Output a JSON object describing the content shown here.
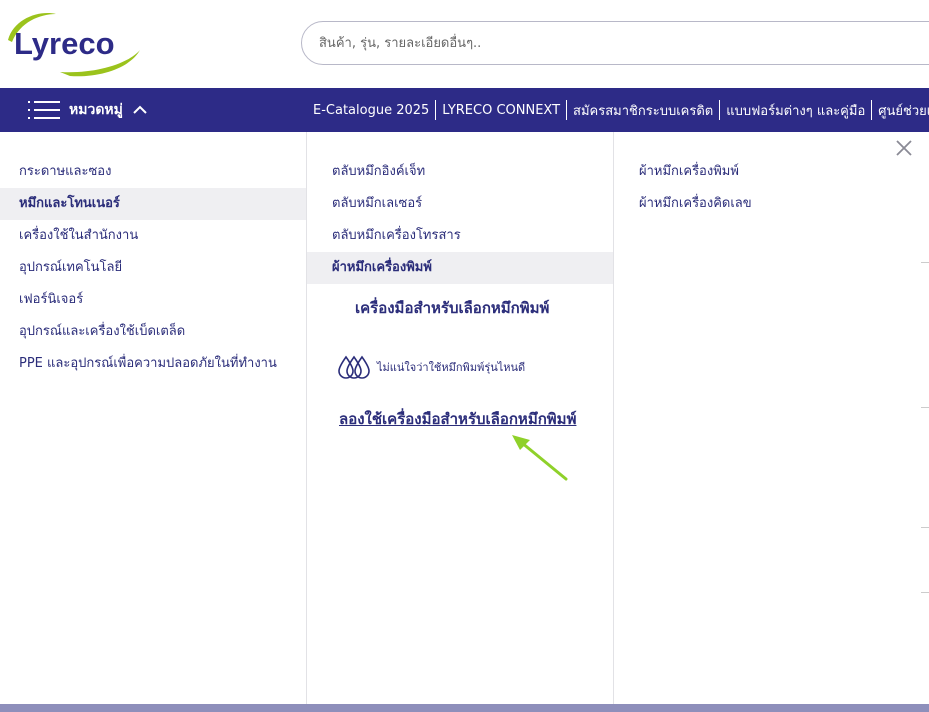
{
  "header": {
    "logo_text": "Lyreco",
    "search_placeholder": "สินค้า, รุ่น, รายละเอียดอื่นๆ.."
  },
  "nav": {
    "categories_label": "หมวดหมู่",
    "links": [
      "E-Catalogue 2025",
      "LYRECO CONNEXT",
      "สมัครสมาชิกระบบเครดิต",
      "แบบฟอร์มต่างๆ และคู่มือ",
      "ศูนย์ช่วยเ"
    ]
  },
  "menu": {
    "level1": [
      "กระดาษและซอง",
      "หมึกและโทนเนอร์",
      "เครื่องใช้ในสำนักงาน",
      "อุปกรณ์เทคโนโลยี",
      "เฟอร์นิเจอร์",
      "อุปกรณ์และเครื่องใช้เบ็ดเตล็ด",
      "PPE และอุปกรณ์เพื่อความปลอดภัยในที่ทำงาน"
    ],
    "level1_active": 1,
    "level2": [
      "ตลับหมึกอิงค์เจ็ท",
      "ตลับหมึกเลเซอร์",
      "ตลับหมึกเครื่องโทรสาร",
      "ผ้าหมึกเครื่องพิมพ์"
    ],
    "level2_active": 3,
    "level3": [
      "ผ้าหมึกเครื่องพิมพ์",
      "ผ้าหมึกเครื่องคิดเลข"
    ],
    "tool": {
      "title": "เครื่องมือสำหรับเลือกหมึกพิมพ์",
      "note": "ไม่แน่ใจว่าใช้หมึกพิมพ์รุ่นไหนดี",
      "link": "ลองใช้เครื่องมือสำหรับเลือกหมึกพิมพ์"
    }
  },
  "colors": {
    "brand_navy": "#2d2b87",
    "brand_green": "#9bc31c",
    "annotation_arrow": "#8fd12a"
  }
}
